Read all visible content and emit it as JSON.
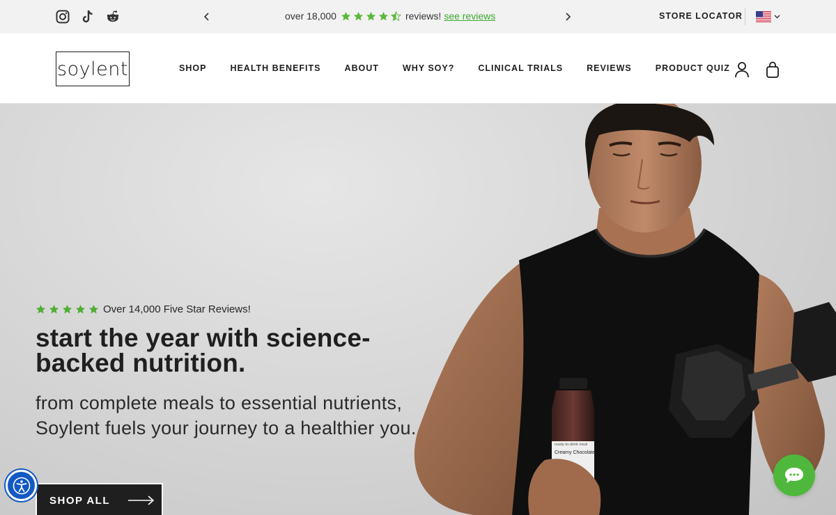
{
  "topbar": {
    "social": [
      {
        "name": "instagram-icon"
      },
      {
        "name": "tiktok-icon"
      },
      {
        "name": "reddit-icon"
      }
    ],
    "promo_prefix": "over 18,000",
    "promo_rating": 4.5,
    "promo_suffix": "reviews!",
    "promo_link": "see reviews",
    "store_locator": "STORE LOCATOR",
    "country": "US"
  },
  "header": {
    "logo": "soylent",
    "nav": [
      {
        "label": "SHOP"
      },
      {
        "label": "HEALTH BENEFITS"
      },
      {
        "label": "ABOUT"
      },
      {
        "label": "WHY SOY?"
      },
      {
        "label": "CLINICAL TRIALS"
      },
      {
        "label": "REVIEWS"
      },
      {
        "label": "PRODUCT QUIZ"
      }
    ]
  },
  "hero": {
    "rating_stars": 5,
    "rating_text": "Over 14,000 Five Star Reviews!",
    "title": "start the year with science-backed nutrition.",
    "subtitle": "from complete meals to essential nutrients, Soylent fuels your journey to a healthier you.",
    "cta": "SHOP ALL",
    "bottle_small": "ready-to-drink meal",
    "bottle_flavor": "Creamy Chocolate"
  },
  "colors": {
    "star_green": "#5cb83b",
    "link_green": "#39a82d",
    "chat_green": "#4fb83c",
    "a11y_blue": "#1358c4",
    "dark": "#1f1f1f"
  }
}
